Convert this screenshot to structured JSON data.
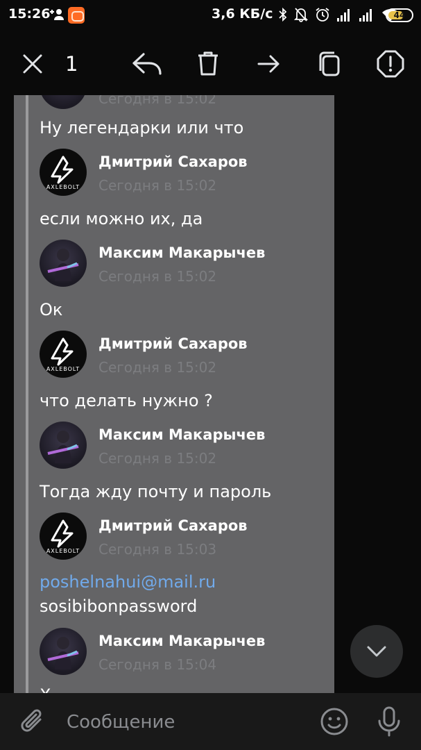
{
  "status_bar": {
    "time": "15:26",
    "net_speed": "3,6 КБ/с",
    "battery": "44",
    "icons": [
      "add-user-icon",
      "app-notification-icon",
      "bluetooth-icon",
      "mute-bell-icon",
      "alarm-icon",
      "signal-icon",
      "signal-icon",
      "wifi-icon",
      "battery-icon"
    ]
  },
  "toolbar": {
    "selected_count": "1",
    "actions": [
      "close",
      "reply",
      "delete",
      "forward",
      "copy",
      "report"
    ]
  },
  "messages": [
    {
      "type": "partial_time",
      "time": "Сегодня в 15:02"
    },
    {
      "type": "text",
      "text": "Ну легендарки или что"
    },
    {
      "type": "author",
      "name": "Дмитрий Сахаров",
      "time": "Сегодня в 15:02",
      "avatar": "axlebolt"
    },
    {
      "type": "text",
      "text": "если можно их, да"
    },
    {
      "type": "author",
      "name": "Максим Макарычев",
      "time": "Сегодня в 15:02",
      "avatar": "photo"
    },
    {
      "type": "text",
      "text": "Ок"
    },
    {
      "type": "author",
      "name": "Дмитрий Сахаров",
      "time": "Сегодня в 15:02",
      "avatar": "axlebolt"
    },
    {
      "type": "text",
      "text": "что делать нужно ?"
    },
    {
      "type": "author",
      "name": "Максим Макарычев",
      "time": "Сегодня в 15:02",
      "avatar": "photo"
    },
    {
      "type": "text",
      "text": "Тогда жду почту и пароль"
    },
    {
      "type": "author",
      "name": "Дмитрий Сахаров",
      "time": "Сегодня в 15:03",
      "avatar": "axlebolt"
    },
    {
      "type": "link",
      "text": "poshelnahui@mail.ru"
    },
    {
      "type": "text",
      "text": "sosibibonpassword"
    },
    {
      "type": "author",
      "name": "Максим Макарычев",
      "time": "Сегодня в 15:04",
      "avatar": "photo"
    },
    {
      "type": "partial_text",
      "text": "Х"
    }
  ],
  "avatar_logo_text": "AXLEBOLT",
  "composer": {
    "placeholder": "Сообщение"
  },
  "colors": {
    "background": "#0a0a0a",
    "bubble": "#646466",
    "link": "#71aaeb",
    "muted_time": "#7c7d80",
    "app_icon": "#ff6b24",
    "battery": "#e8c34b"
  }
}
